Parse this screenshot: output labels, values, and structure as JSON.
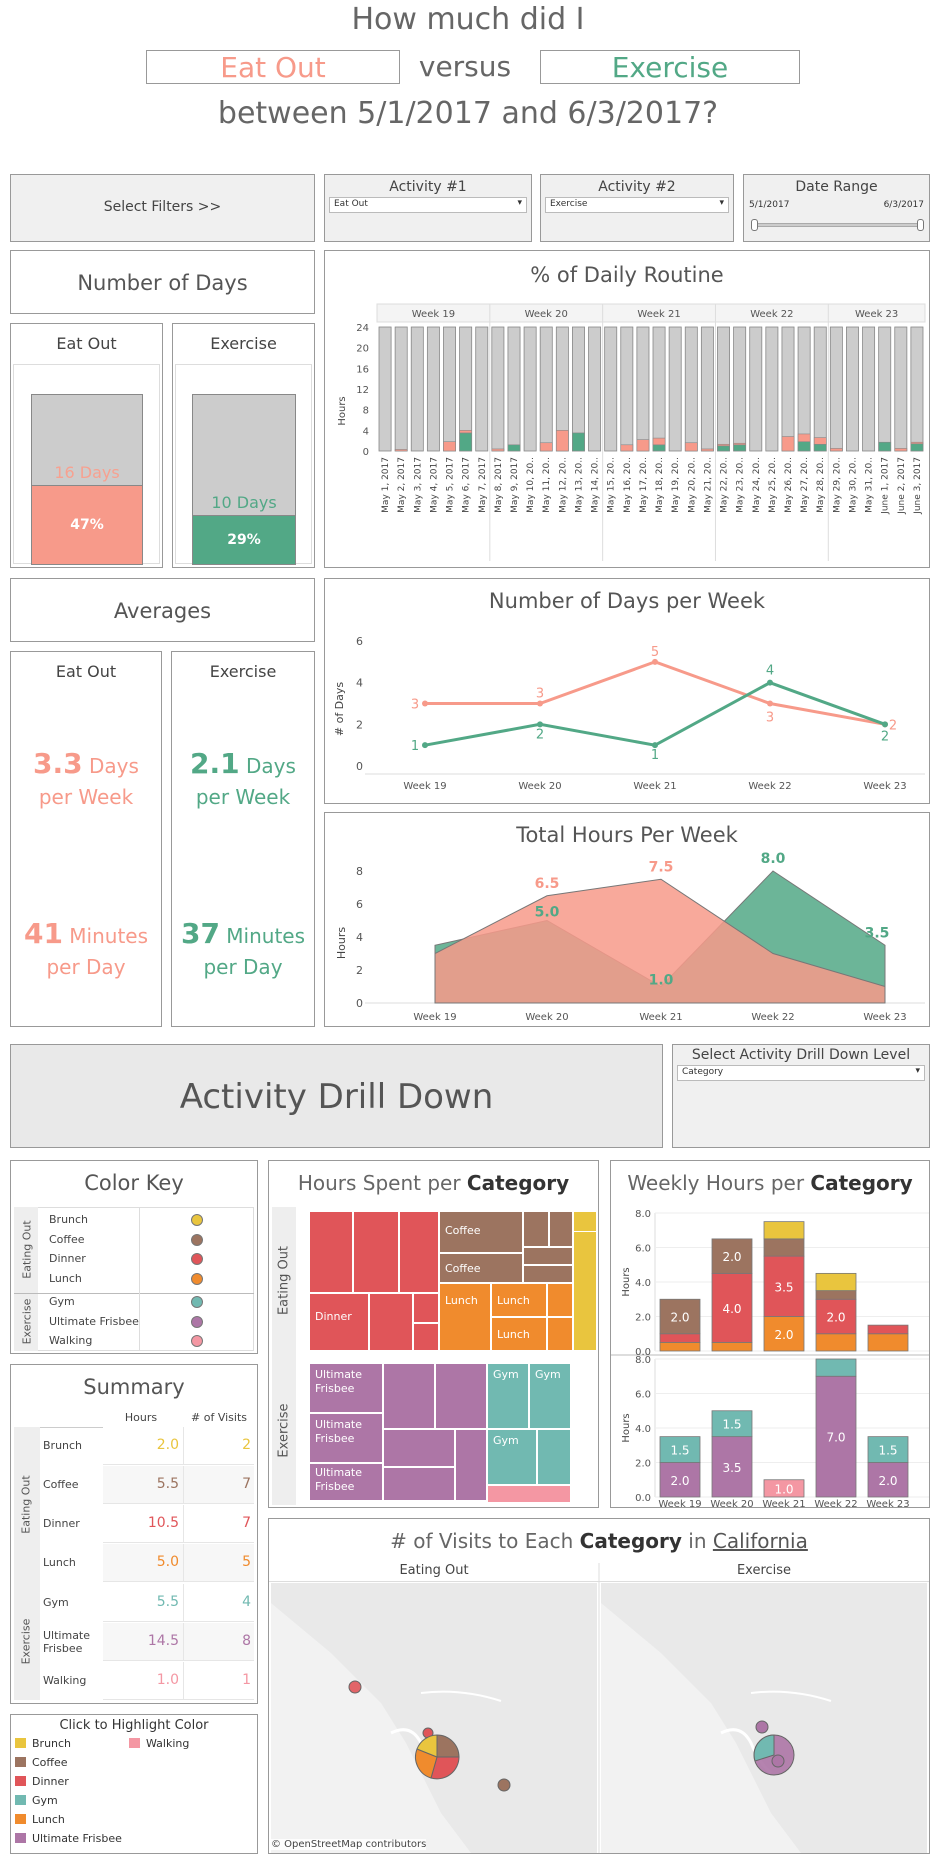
{
  "header": {
    "line1": "How much did I",
    "activity1": "Eat Out",
    "versus": "versus",
    "activity2": "Exercise",
    "line3": "between 5/1/2017 and 6/3/2017?"
  },
  "colors": {
    "eat": "#f79a8a",
    "exercise": "#52a886",
    "grayBar": "#cccccc",
    "brunch": "#e9c53e",
    "coffee": "#9c7460",
    "dinner": "#e05559",
    "lunch": "#f08b2d",
    "gym": "#71b9b1",
    "frisbee": "#ad76a6",
    "walking": "#f497a3"
  },
  "filters": {
    "select_label": "Select Filters >>",
    "act1_title": "Activity #1",
    "act1_value": "Eat Out",
    "act2_title": "Activity #2",
    "act2_value": "Exercise",
    "range_title": "Date Range",
    "range_start": "5/1/2017",
    "range_end": "6/3/2017"
  },
  "days": {
    "title": "Number of Days",
    "eat_title": "Eat Out",
    "eat_days": "16 Days",
    "eat_pct": "47%",
    "eat_fraction": 0.47,
    "ex_title": "Exercise",
    "ex_days": "10 Days",
    "ex_pct": "29%",
    "ex_fraction": 0.29
  },
  "routine": {
    "title": "% of Daily Routine",
    "ylabel": "Hours",
    "weeks": [
      "Week 19",
      "Week 20",
      "Week 21",
      "Week 22",
      "Week 23"
    ]
  },
  "averages": {
    "title": "Averages",
    "eat_title": "Eat Out",
    "eat_days_num": "3.3",
    "eat_days_unit": "Days",
    "eat_per_week": "per Week",
    "eat_min_num": "41",
    "eat_min_unit": "Minutes",
    "eat_per_day": "per Day",
    "ex_title": "Exercise",
    "ex_days_num": "2.1",
    "ex_days_unit": "Days",
    "ex_per_week": "per Week",
    "ex_min_num": "37",
    "ex_min_unit": "Minutes",
    "ex_per_day": "per Day"
  },
  "drill": {
    "title": "Activity Drill Down",
    "select_title": "Select Activity Drill Down Level",
    "select_value": "Category"
  },
  "colorkey": {
    "title": "Color Key",
    "group1": "Eating Out",
    "group2": "Exercise",
    "items": [
      "Brunch",
      "Coffee",
      "Dinner",
      "Lunch",
      "Gym",
      "Ultimate Frisbee",
      "Walking"
    ]
  },
  "summary": {
    "title": "Summary",
    "col_hours": "Hours",
    "col_visits": "# of Visits",
    "group1": "Eating Out",
    "group2": "Exercise",
    "rows": [
      {
        "name": "Brunch",
        "hours": "2.0",
        "visits": "2"
      },
      {
        "name": "Coffee",
        "hours": "5.5",
        "visits": "7"
      },
      {
        "name": "Dinner",
        "hours": "10.5",
        "visits": "7"
      },
      {
        "name": "Lunch",
        "hours": "5.0",
        "visits": "5"
      },
      {
        "name": "Gym",
        "hours": "5.5",
        "visits": "4"
      },
      {
        "name": "Ultimate\nFrisbee",
        "hours": "14.5",
        "visits": "8"
      },
      {
        "name": "Walking",
        "hours": "1.0",
        "visits": "1"
      }
    ]
  },
  "highlight": {
    "title": "Click to Highlight Color",
    "items": [
      "Brunch",
      "Coffee",
      "Dinner",
      "Gym",
      "Lunch",
      "Ultimate Frisbee",
      "Walking"
    ]
  },
  "treemap": {
    "title_pre": "Hours Spent per ",
    "title_bold": "Category",
    "group1": "Eating Out",
    "group2": "Exercise",
    "labels": {
      "coffee": "Coffee",
      "dinner": "Dinner",
      "lunch": "Lunch",
      "frisbee": "Ultimate Frisbee",
      "gym": "Gym"
    }
  },
  "weekly": {
    "title_pre": "Weekly Hours per ",
    "title_bold": "Category",
    "ylabel": "Hours"
  },
  "map": {
    "title_pre": "# of Visits to Each ",
    "title_bold": "Category",
    "title_mid": " in ",
    "title_link": "California",
    "left_title": "Eating Out",
    "right_title": "Exercise",
    "credit": "© OpenStreetMap contributors"
  },
  "chart_data": [
    {
      "type": "bar",
      "title": "% of Daily Routine",
      "ylabel": "Hours",
      "ylim": [
        0,
        24
      ],
      "yticks": [
        0,
        4,
        8,
        12,
        16,
        20,
        24
      ],
      "groups": [
        "Week 19",
        "Week 20",
        "Week 21",
        "Week 22",
        "Week 23"
      ],
      "categories": [
        "May 1, 2017",
        "May 2, 2017",
        "May 3, 2017",
        "May 4, 2017",
        "May 5, 2017",
        "May 6, 2017",
        "May 7, 2017",
        "May 8, 2017",
        "May 9, 2017",
        "May 10, 20..",
        "May 11, 20..",
        "May 12, 20..",
        "May 13, 20..",
        "May 14, 20..",
        "May 15, 20..",
        "May 16, 20..",
        "May 17, 20..",
        "May 18, 20..",
        "May 19, 20..",
        "May 20, 20..",
        "May 21, 20..",
        "May 22, 20..",
        "May 23, 20..",
        "May 24, 20..",
        "May 25, 20..",
        "May 26, 20..",
        "May 27, 20..",
        "May 28, 20..",
        "May 29, 20..",
        "May 30, 20..",
        "May 31, 20..",
        "June 1, 2017",
        "June 2, 2017",
        "June 3, 2017"
      ],
      "series": [
        {
          "name": "Eat Out",
          "values": [
            0,
            0.3,
            0,
            0,
            1.8,
            0.5,
            0,
            0.4,
            0,
            0,
            1.6,
            4,
            0,
            0,
            0,
            1.2,
            2.2,
            1.3,
            0,
            1.6,
            0.4,
            0.3,
            0.3,
            0,
            0,
            2.8,
            1.5,
            1.3,
            0.5,
            0,
            0,
            0,
            0.5,
            0.3
          ]
        },
        {
          "name": "Exercise",
          "values": [
            0,
            0,
            0,
            0,
            0,
            3.5,
            0,
            0,
            1.2,
            0,
            0,
            0,
            3.5,
            0,
            0,
            0,
            0,
            1.2,
            0,
            0,
            0,
            1,
            1.2,
            0,
            0,
            0,
            1.8,
            1.3,
            0,
            0,
            0,
            1.7,
            0,
            1.4
          ]
        }
      ]
    },
    {
      "type": "line",
      "title": "Number of Days per Week",
      "ylabel": "# of Days",
      "ylim": [
        0,
        6
      ],
      "yticks": [
        0,
        2,
        4,
        6
      ],
      "categories": [
        "Week 19",
        "Week 20",
        "Week 21",
        "Week 22",
        "Week 23"
      ],
      "series": [
        {
          "name": "Eat Out",
          "values": [
            3,
            3,
            5,
            3,
            2
          ]
        },
        {
          "name": "Exercise",
          "values": [
            1,
            2,
            1,
            4,
            2
          ]
        }
      ]
    },
    {
      "type": "area",
      "title": "Total Hours Per Week",
      "ylabel": "Hours",
      "ylim": [
        0,
        8
      ],
      "yticks": [
        0,
        2,
        4,
        6,
        8
      ],
      "categories": [
        "Week 19",
        "Week 20",
        "Week 21",
        "Week 22",
        "Week 23"
      ],
      "series": [
        {
          "name": "Eat Out",
          "values": [
            3.0,
            6.5,
            7.5,
            3.0,
            1.0
          ]
        },
        {
          "name": "Exercise",
          "values": [
            3.5,
            5.0,
            1.0,
            8.0,
            3.5
          ]
        }
      ],
      "labels": [
        {
          "series": "Eat Out",
          "text": "6.5",
          "index": 1
        },
        {
          "series": "Exercise",
          "text": "5.0",
          "index": 1
        },
        {
          "series": "Eat Out",
          "text": "7.5",
          "index": 2
        },
        {
          "series": "Exercise",
          "text": "1.0",
          "index": 2
        },
        {
          "series": "Exercise",
          "text": "8.0",
          "index": 3
        },
        {
          "series": "Exercise",
          "text": "3.5",
          "index": 4
        }
      ]
    },
    {
      "type": "bar",
      "title": "Weekly Hours per Category",
      "stacked": true,
      "categories": [
        "Week 19",
        "Week 20",
        "Week 21",
        "Week 22",
        "Week 23"
      ],
      "ylim": [
        0,
        8
      ],
      "yticks": [
        "0.0",
        "2.0",
        "4.0",
        "6.0",
        "8.0"
      ],
      "panels": [
        {
          "name": "Eating Out",
          "series": [
            {
              "name": "Lunch",
              "values": [
                0.5,
                0.5,
                2.0,
                1.0,
                1.0
              ]
            },
            {
              "name": "Dinner",
              "values": [
                0.5,
                4.0,
                3.5,
                2.0,
                0.5
              ]
            },
            {
              "name": "Coffee",
              "values": [
                2.0,
                2.0,
                1.0,
                0.5,
                0
              ]
            },
            {
              "name": "Brunch",
              "values": [
                0,
                0,
                1.0,
                1.0,
                0
              ]
            }
          ],
          "labels": [
            {
              "text": "2.0",
              "index": 0,
              "series": "Coffee"
            },
            {
              "text": "4.0",
              "index": 1,
              "series": "Dinner"
            },
            {
              "text": "2.0",
              "index": 1,
              "series": "Coffee"
            },
            {
              "text": "2.0",
              "index": 2,
              "series": "Lunch"
            },
            {
              "text": "3.5",
              "index": 2,
              "series": "Dinner"
            },
            {
              "text": "2.0",
              "index": 3,
              "series": "Dinner"
            }
          ]
        },
        {
          "name": "Exercise",
          "series": [
            {
              "name": "Ultimate Frisbee",
              "values": [
                2.0,
                3.5,
                0,
                7.0,
                2.0
              ]
            },
            {
              "name": "Walking",
              "values": [
                0,
                0,
                1.0,
                0,
                0
              ]
            },
            {
              "name": "Gym",
              "values": [
                1.5,
                1.5,
                0,
                1.0,
                1.5
              ]
            }
          ],
          "labels": [
            {
              "text": "1.5",
              "index": 0,
              "series": "Gym"
            },
            {
              "text": "2.0",
              "index": 0,
              "series": "Ultimate Frisbee"
            },
            {
              "text": "1.5",
              "index": 1,
              "series": "Gym"
            },
            {
              "text": "3.5",
              "index": 1,
              "series": "Ultimate Frisbee"
            },
            {
              "text": "1.0",
              "index": 2,
              "series": "Walking"
            },
            {
              "text": "7.0",
              "index": 3,
              "series": "Ultimate Frisbee"
            },
            {
              "text": "1.5",
              "index": 4,
              "series": "Gym"
            },
            {
              "text": "2.0",
              "index": 4,
              "series": "Ultimate Frisbee"
            }
          ]
        }
      ]
    }
  ]
}
